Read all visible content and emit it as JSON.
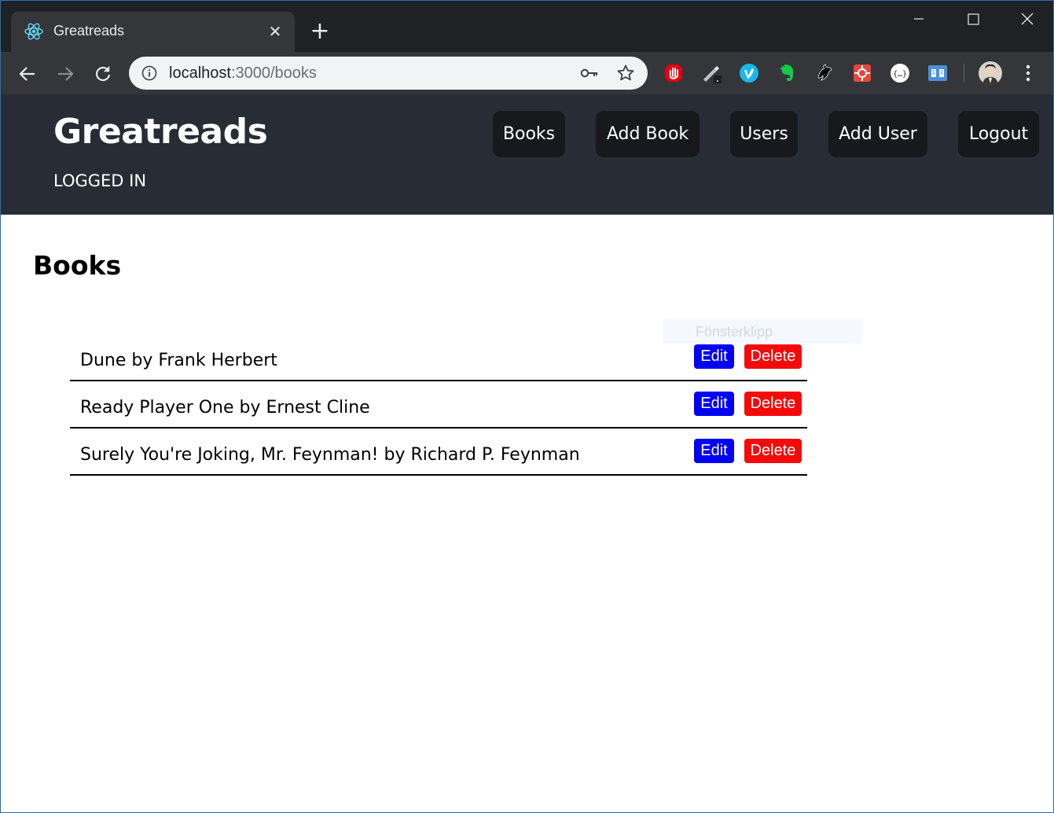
{
  "browser": {
    "tab": {
      "title": "Greatreads",
      "favicon": "react-icon",
      "close_glyph": "✕"
    },
    "new_tab_glyph": "+",
    "address": {
      "host": "localhost",
      "path": ":3000/books"
    },
    "icons": {
      "back": "back-arrow-icon",
      "forward": "forward-arrow-icon",
      "reload": "reload-icon",
      "info": "info-icon",
      "key": "key-icon",
      "star": "star-icon",
      "menu": "vertical-dots-icon"
    },
    "extensions": [
      "ublock-icon",
      "pen-icon",
      "vimeo-icon",
      "evernote-icon",
      "bird-icon",
      "extension-red-icon",
      "json-viewer-icon",
      "reader-icon"
    ]
  },
  "header": {
    "brand": "Greatreads",
    "status": "LOGGED IN",
    "nav": {
      "books": "Books",
      "add_book": "Add Book",
      "users": "Users",
      "add_user": "Add User",
      "logout": "Logout"
    }
  },
  "main": {
    "title": "Books",
    "edit_label": "Edit",
    "delete_label": "Delete",
    "books": [
      "Dune by Frank Herbert",
      "Ready Player One by Ernest Cline",
      "Surely You're Joking, Mr. Feynman! by Richard P. Feynman"
    ]
  },
  "overlay": {
    "snip_label": "Fönsterklipp"
  },
  "colors": {
    "chrome_dark": "#202124",
    "header_bg": "#282c34",
    "nav_btn_bg": "#17191d",
    "edit_bg": "#0000f5",
    "delete_bg": "#f50a0a"
  }
}
